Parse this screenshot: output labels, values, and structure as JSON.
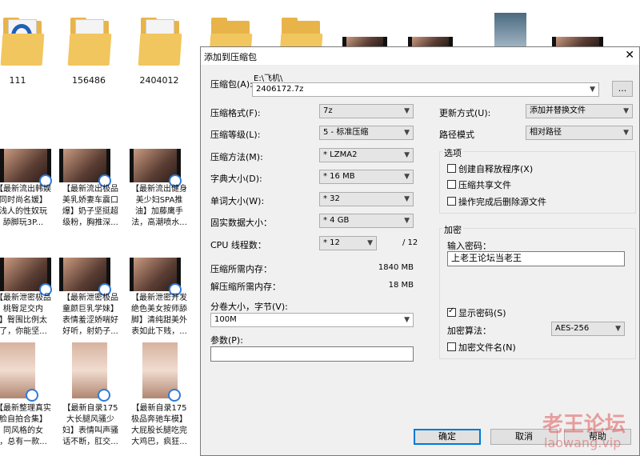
{
  "desktop": {
    "folders": [
      {
        "label": "111"
      },
      {
        "label": "156486"
      },
      {
        "label": "2404012"
      },
      {
        "label": ""
      },
      {
        "label": ""
      }
    ],
    "row1_labels": [
      "【最新流出韩娱\n同时尚名媛】\n浅人的性奴玩\n舔脚玩3P...",
      "【最新流出极品\n美乳娇妻车震口\n爆】奶子坚挺超\n级粉，胸推深...",
      "【最新流出健身\n美少妇SPA推\n油】加藤鹰手\n法，高潮喷水..."
    ],
    "row2_labels": [
      "【最新泄密极品\n桃臀足交内\n】臀围比例太\n了，你能坚...",
      "【最新泄密极品\n童颜巨乳学妹】\n表情羞涩娇喘好\n好听，射奶子...",
      "【最新泄密开发\n绝色美女按师舔\n脚】清纯甜美外\n表如此下贱，..."
    ],
    "row3_labels": [
      "【最新整理真实\n脸自拍合集】\n同风格的女\n，总有一款...",
      "【最新自录175\n大长腿风骚少\n妇】表情叫声骚\n话不断，肛交...",
      "【最新自录175\n极品奔驰车模】\n大屁股长腿吃完\n大鸡巴，疯狂..."
    ]
  },
  "dialog": {
    "title": "添加到压缩包",
    "archive_label": "压缩包(A):",
    "archive_path_prefix": "E:\\飞机\\",
    "archive_name": "2406172.7z",
    "browse_label": "...",
    "format_label": "压缩格式(F):",
    "format_value": "7z",
    "level_label": "压缩等级(L):",
    "level_value": "5 - 标准压缩",
    "method_label": "压缩方法(M):",
    "method_value": "* LZMA2",
    "dict_label": "字典大小(D):",
    "dict_value": "* 16 MB",
    "word_label": "单词大小(W):",
    "word_value": "* 32",
    "solid_label": "固实数据大小：",
    "solid_value": "* 4 GB",
    "threads_label": "CPU 线程数：",
    "threads_value": "* 12",
    "threads_max": "/ 12",
    "mem_comp_label": "压缩所需内存：",
    "mem_comp_value": "1840 MB",
    "mem_decomp_label": "解压缩所需内存：",
    "mem_decomp_value": "18 MB",
    "split_label": "分卷大小，字节(V):",
    "split_value": "100M",
    "params_label": "参数(P):",
    "params_value": "",
    "update_label": "更新方式(U):",
    "update_value": "添加并替换文件",
    "pathmode_label": "路径模式",
    "pathmode_value": "相对路径",
    "options_title": "选项",
    "opt_sfx": "创建自释放程序(X)",
    "opt_shared": "压缩共享文件",
    "opt_delete": "操作完成后删除源文件",
    "encrypt_title": "加密",
    "password_label": "输入密码：",
    "password_value": "上老王论坛当老王",
    "show_password": "显示密码(S)",
    "enc_method_label": "加密算法：",
    "enc_method_value": "AES-256",
    "enc_names": "加密文件名(N)",
    "ok": "确定",
    "cancel": "取消",
    "help": "帮助"
  },
  "watermark": {
    "line1": "老王论坛",
    "line2": "laowang.vip"
  }
}
